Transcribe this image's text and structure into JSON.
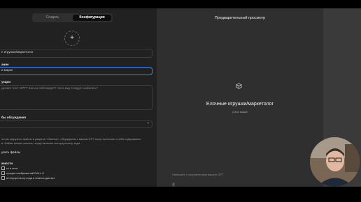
{
  "tabs": {
    "create": "Создать",
    "configure": "Конфигурация"
  },
  "left": {
    "add_icon": "plus-icon",
    "name_value": "е игрушки/маркетолог",
    "description_label": "ание",
    "description_value": "и марке",
    "instructions_label": "укции",
    "instructions_value": "делает этот GPT? Как он себя ведет? Чего ему следует избегать?",
    "starters_label": "бы обсуждения",
    "starters_close": "×",
    "knowledge_text_1": "ли вы загрузите файлы в разделе «Знания», обсуждения с вашим GPT могут включать в себя содержимое",
    "knowledge_text_2": "в. Файлы можно скачать, когда включен интерпретатор кода",
    "upload_label": "узить файлы",
    "capabilities_label": "жности",
    "cap_1": "ск в сети",
    "cap_2": "ерация изображений DALL·E",
    "cap_3": "интерпретатор кода и анализ данных"
  },
  "preview": {
    "title": "Предварительный просмотр",
    "gpt_icon": "cube-icon",
    "gpt_name": "Елочные игрушки/маркетолог",
    "gpt_desc": "сутки марке",
    "prompt_placeholder": "Напишите с отправлением вашего GPT",
    "attach_icon": "paperclip-icon"
  },
  "colors": {
    "accent": "#3b82f6",
    "panel_left": "#212121",
    "panel_right": "#2f2f2f"
  }
}
